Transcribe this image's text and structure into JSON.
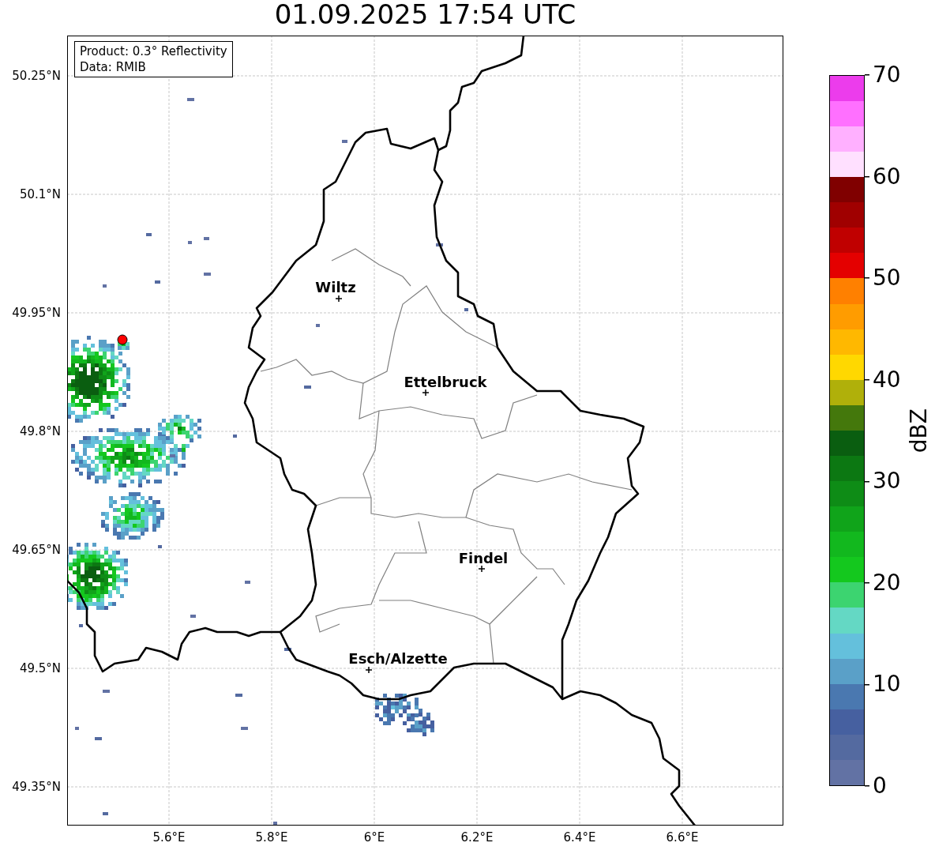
{
  "title": "01.09.2025 17:54 UTC",
  "info_box": [
    "Product: 0.3° Reflectivity",
    "Data: RMIB"
  ],
  "map": {
    "cities": [
      {
        "name": "Wiltz"
      },
      {
        "name": "Ettelbruck"
      },
      {
        "name": "Findel"
      },
      {
        "name": "Esch/Alzette"
      }
    ],
    "lat_ticks": [
      "50.25°N",
      "50.1°N",
      "49.95°N",
      "49.8°N",
      "49.65°N",
      "49.5°N",
      "49.35°N"
    ],
    "lon_ticks": [
      "5.6°E",
      "5.8°E",
      "6°E",
      "6.2°E",
      "6.4°E",
      "6.6°E"
    ]
  },
  "colorbar": {
    "label": "dBZ",
    "ticks": [
      "70",
      "60",
      "50",
      "40",
      "30",
      "20",
      "10",
      "0"
    ],
    "segments": [
      {
        "color": "#6272a4"
      },
      {
        "color": "#546aa0"
      },
      {
        "color": "#4660a0"
      },
      {
        "color": "#4a78b0"
      },
      {
        "color": "#5aa0c8"
      },
      {
        "color": "#64c0dc"
      },
      {
        "color": "#64d8c4"
      },
      {
        "color": "#3cd470"
      },
      {
        "color": "#14c81e"
      },
      {
        "color": "#12b81e"
      },
      {
        "color": "#10a41a"
      },
      {
        "color": "#0e8c16"
      },
      {
        "color": "#0c7812"
      },
      {
        "color": "#0a5e10"
      },
      {
        "color": "#44780c"
      },
      {
        "color": "#b0b00a"
      },
      {
        "color": "#ffd800"
      },
      {
        "color": "#ffb800"
      },
      {
        "color": "#ff9c00"
      },
      {
        "color": "#ff8000"
      },
      {
        "color": "#e40000"
      },
      {
        "color": "#c00000"
      },
      {
        "color": "#a00000"
      },
      {
        "color": "#800000"
      },
      {
        "color": "#ffe0ff"
      },
      {
        "color": "#ffb0ff"
      },
      {
        "color": "#ff70ff"
      },
      {
        "color": "#ec3cec"
      }
    ]
  }
}
